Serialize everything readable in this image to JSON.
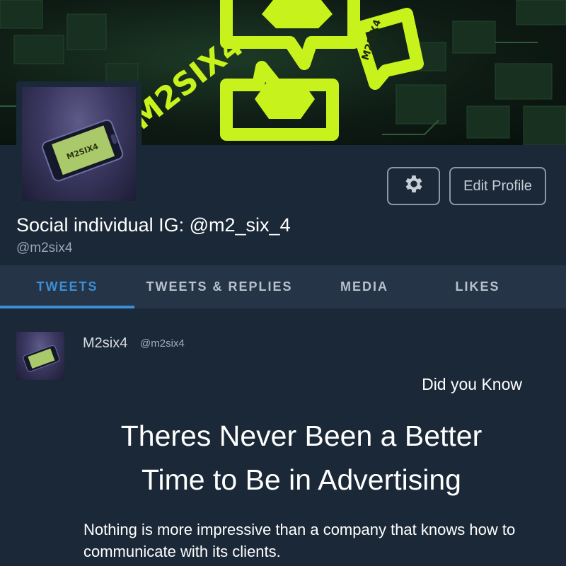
{
  "profile": {
    "display_name": "Social individual IG: @m2_six_4",
    "handle": "@m2six4",
    "banner_text": [
      "M2SIX4",
      "M2SIX4"
    ],
    "avatar_text": "M2SIX4"
  },
  "actions": {
    "settings_icon": "gear-icon",
    "edit_profile_label": "Edit Profile"
  },
  "tabs": [
    {
      "label": "TWEETS",
      "active": true
    },
    {
      "label": "TWEETS & REPLIES",
      "active": false
    },
    {
      "label": "MEDIA",
      "active": false
    },
    {
      "label": "LIKES",
      "active": false
    }
  ],
  "tweet": {
    "author": "M2six4",
    "handle": "@m2six4",
    "intro": "Did you Know",
    "headline_line1": "Theres Never Been a Better",
    "headline_line2": "Time to Be in Advertising",
    "body": "Nothing is more impressive than a company that knows how to communicate with its clients."
  },
  "colors": {
    "background": "#1b2837",
    "tab_bar": "#253447",
    "accent": "#3a8fd6",
    "brand_lime": "#c8f21c"
  }
}
